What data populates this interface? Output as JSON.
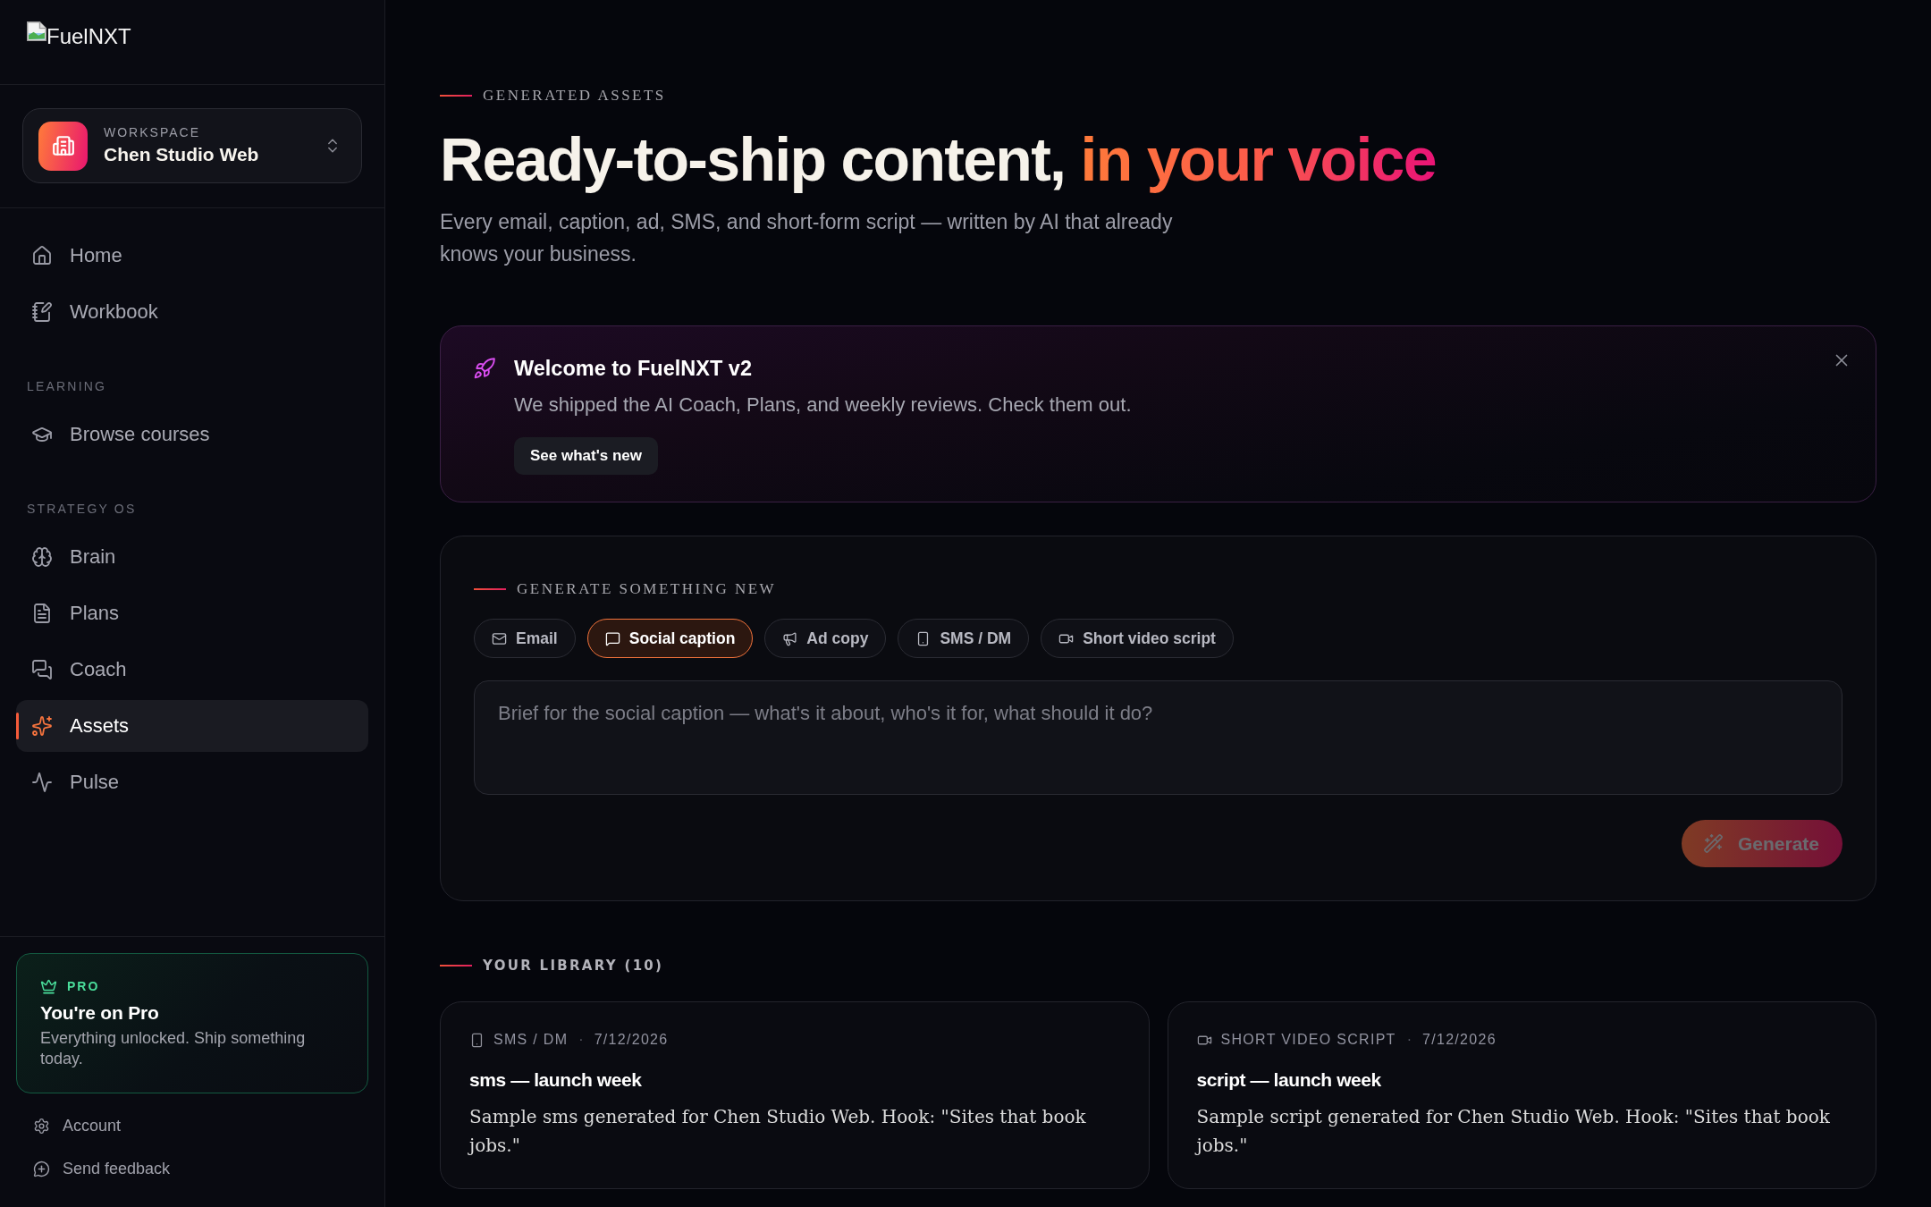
{
  "sidebar": {
    "logo": {
      "alt_text": "FuelNXT"
    },
    "workspace": {
      "label": "WORKSPACE",
      "name": "Chen Studio Web"
    },
    "nav_sections": [
      {
        "items": [
          {
            "label": "Home",
            "selected": false
          },
          {
            "label": "Workbook",
            "selected": false
          }
        ]
      },
      {
        "heading": "LEARNING",
        "items": [
          {
            "label": "Browse courses",
            "selected": false
          }
        ]
      },
      {
        "heading": "STRATEGY OS",
        "items": [
          {
            "label": "Brain",
            "selected": false
          },
          {
            "label": "Plans",
            "selected": false
          },
          {
            "label": "Coach",
            "selected": false
          },
          {
            "label": "Assets",
            "selected": true
          },
          {
            "label": "Pulse",
            "selected": false
          }
        ]
      }
    ],
    "plan_card": {
      "badge": "PRO",
      "title": "You're on Pro",
      "text": "Everything unlocked. Ship something today."
    },
    "links": [
      {
        "label": "Account"
      },
      {
        "label": "Send feedback"
      }
    ]
  },
  "page": {
    "eyebrow": "GENERATED ASSETS",
    "heading": {
      "text": "Ready-to-ship content,",
      "highlight": "in your voice"
    },
    "subtitle": "Every email, caption, ad, SMS, and short-form script — written by AI that already knows your business.",
    "announcement": {
      "title": "Welcome to FuelNXT v2",
      "text": "We shipped the AI Coach, Plans, and weekly reviews. Check them out.",
      "button": "See what's new"
    },
    "generator": {
      "eyebrow": "GENERATE SOMETHING NEW",
      "types": [
        {
          "label": "Email",
          "selected": false
        },
        {
          "label": "Social caption",
          "selected": true
        },
        {
          "label": "Ad copy",
          "selected": false
        },
        {
          "label": "SMS / DM",
          "selected": false
        },
        {
          "label": "Short video script",
          "selected": false
        }
      ],
      "brief": {
        "placeholder": "Brief for the social caption — what's it about, who's it for, what should it do?"
      },
      "generate_button": {
        "label": "Generate",
        "disabled": true
      }
    },
    "library": {
      "title": "YOUR LIBRARY (10)",
      "items": [
        {
          "kind": "sms",
          "type": "SMS / DM",
          "separator": "·",
          "date": "7/12/2026",
          "title": "sms — launch week",
          "excerpt": "Sample sms generated for Chen Studio Web. Hook: \"Sites that book jobs.\""
        },
        {
          "kind": "video",
          "type": "SHORT VIDEO SCRIPT",
          "separator": "·",
          "date": "7/12/2026",
          "title": "script — launch week",
          "excerpt": "Sample script generated for Chen Studio Web. Hook: \"Sites that book jobs.\""
        }
      ]
    }
  }
}
